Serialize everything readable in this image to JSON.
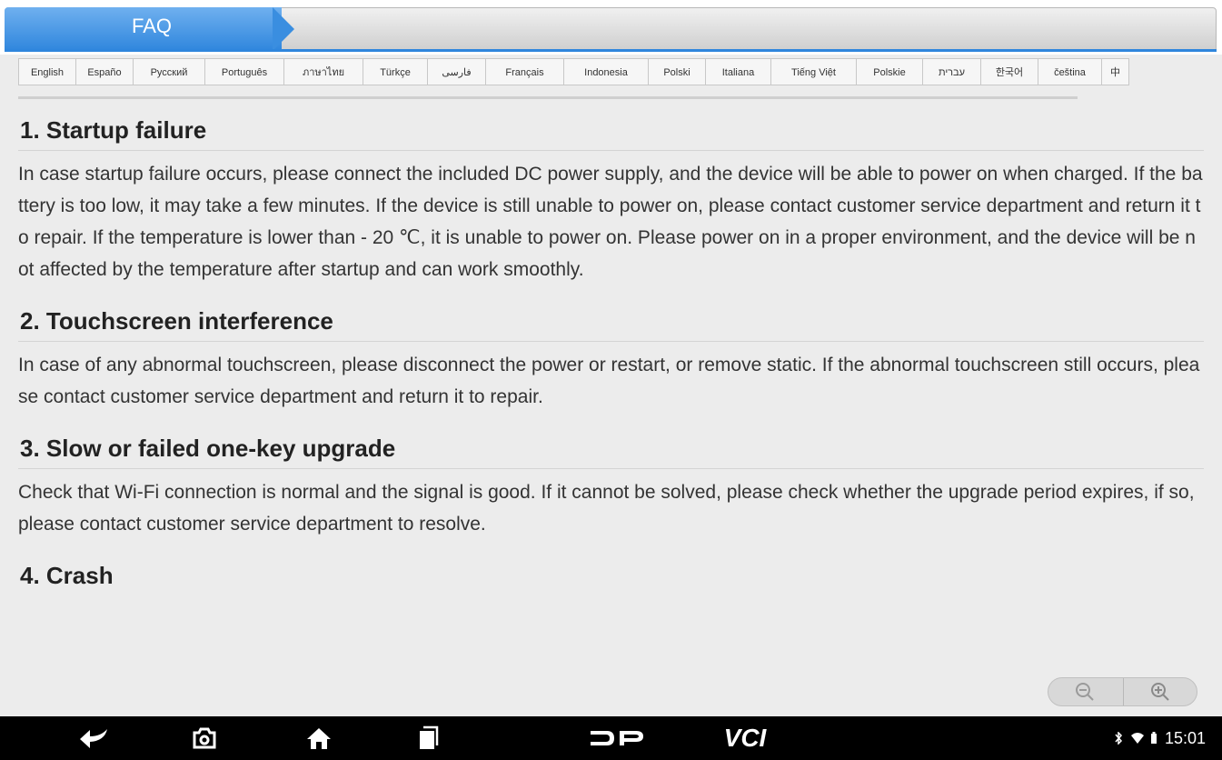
{
  "header": {
    "tab_label": "FAQ"
  },
  "languages": [
    "English",
    "Españo",
    "Русский",
    "Português",
    "ภาษาไทย",
    "Türkçe",
    "فارسی",
    "Français",
    "Indonesia",
    "Polski",
    "Italiana",
    "Tiếng Việt",
    "Polskie",
    "עברית",
    "한국어",
    "čeština",
    "中"
  ],
  "sections": [
    {
      "title": "1. Startup failure",
      "body": "In case startup failure occurs, please connect the included DC power supply, and the device will be able to power on when charged. If the battery is too low, it may take a few minutes. If the device is still unable to power on, please contact customer service department and return it to repair. If the temperature is lower than - 20 ℃, it is unable to power on. Please power on in a proper environment, and the device will be not affected by the temperature after startup and can work smoothly."
    },
    {
      "title": "2. Touchscreen interference",
      "body": "In case of any abnormal touchscreen, please disconnect the power or restart, or remove static. If the abnormal touchscreen still occurs, please contact customer service department and return it to repair."
    },
    {
      "title": "3. Slow or failed one-key upgrade",
      "body": "Check that Wi-Fi connection is normal and the signal is good. If it cannot be solved, please check whether the upgrade period expires, if so, please contact customer service department to resolve."
    },
    {
      "title": "4. Crash",
      "body": ""
    }
  ],
  "navbar": {
    "icons": [
      "back-icon",
      "camera-icon",
      "home-icon",
      "recent-apps-icon",
      "dp-logo",
      "vci-label"
    ],
    "vci_label": "VCI",
    "dp_label": "DP"
  },
  "status": {
    "time": "15:01"
  },
  "colors": {
    "accent": "#2f86dd",
    "background": "#ececec",
    "navbar": "#000000"
  }
}
